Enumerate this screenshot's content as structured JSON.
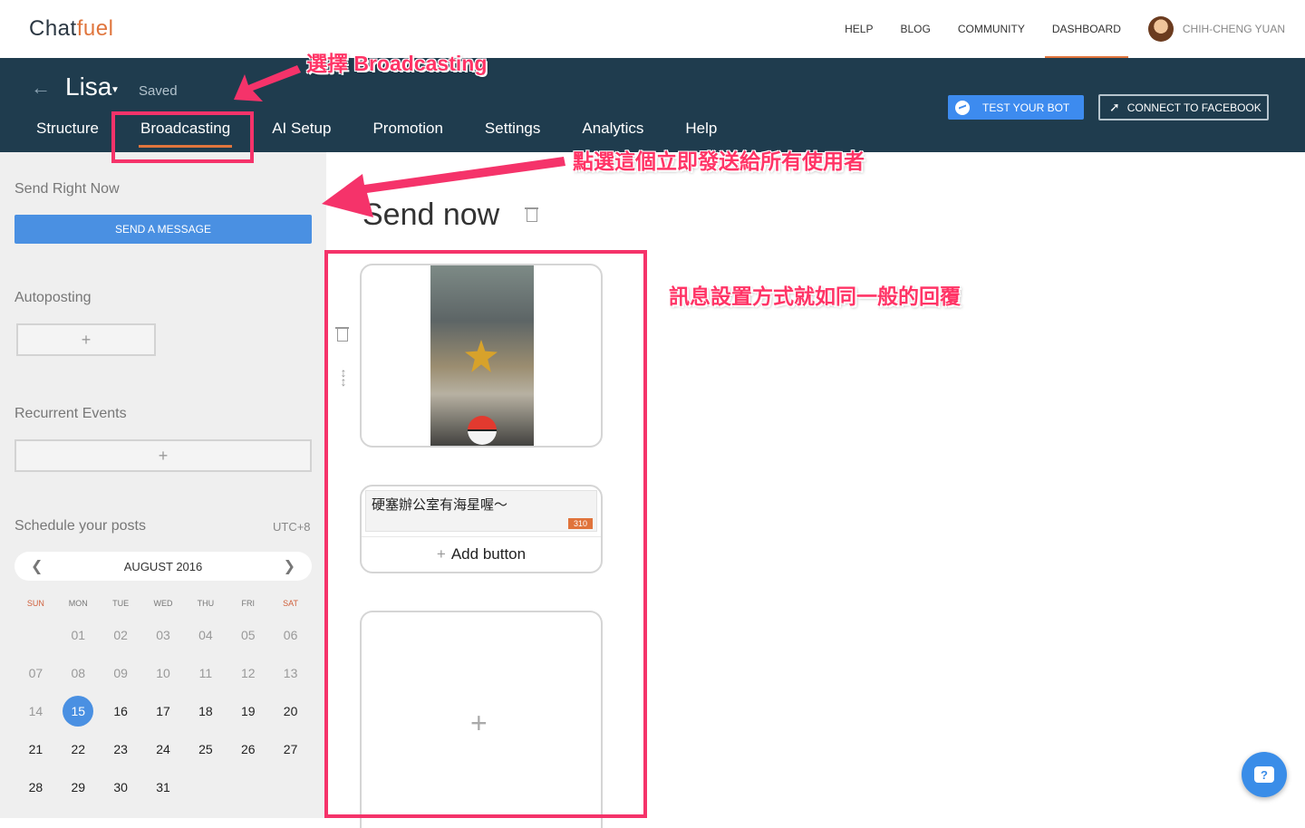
{
  "topnav": {
    "logo_main": "Chat",
    "logo_accent": "fuel",
    "links": [
      "HELP",
      "BLOG",
      "COMMUNITY",
      "DASHBOARD"
    ],
    "active_link": "DASHBOARD",
    "username": "CHIH-CHENG YUAN"
  },
  "header": {
    "bot_name": "Lisa",
    "status": "Saved",
    "tabs": [
      "Structure",
      "Broadcasting",
      "AI Setup",
      "Promotion",
      "Settings",
      "Analytics",
      "Help"
    ],
    "active_tab": "Broadcasting",
    "test_bot_label": "TEST YOUR BOT",
    "connect_fb_label": "CONNECT TO FACEBOOK"
  },
  "sidebar": {
    "send_right_now": "Send Right Now",
    "send_message_label": "SEND A MESSAGE",
    "autoposting": "Autoposting",
    "recurrent_events": "Recurrent Events",
    "schedule": "Schedule your posts",
    "timezone": "UTC+8",
    "month": "AUGUST 2016",
    "weekdays": [
      "SUN",
      "MON",
      "TUE",
      "WED",
      "THU",
      "FRI",
      "SAT"
    ],
    "today": "15",
    "weeks": [
      [
        "",
        "01",
        "02",
        "03",
        "04",
        "05",
        "06"
      ],
      [
        "07",
        "08",
        "09",
        "10",
        "11",
        "12",
        "13"
      ],
      [
        "14",
        "15",
        "16",
        "17",
        "18",
        "19",
        "20"
      ],
      [
        "21",
        "22",
        "23",
        "24",
        "25",
        "26",
        "27"
      ],
      [
        "28",
        "29",
        "30",
        "31",
        "",
        "",
        ""
      ]
    ]
  },
  "main": {
    "title": "Send now",
    "text_card_content": "硬塞辦公室有海星喔～",
    "char_counter": "310",
    "add_button_label": "Add button"
  },
  "annotations": {
    "select_broadcasting": "選擇 Broadcasting",
    "click_send_all": "點選這個立即發送給所有使用者",
    "message_setup": "訊息設置方式就如同一般的回覆"
  },
  "colors": {
    "header_bg": "#1f3c4e",
    "accent_orange": "#e0753d",
    "primary_blue": "#4a90e2",
    "annotation_pink": "#f5336a"
  }
}
